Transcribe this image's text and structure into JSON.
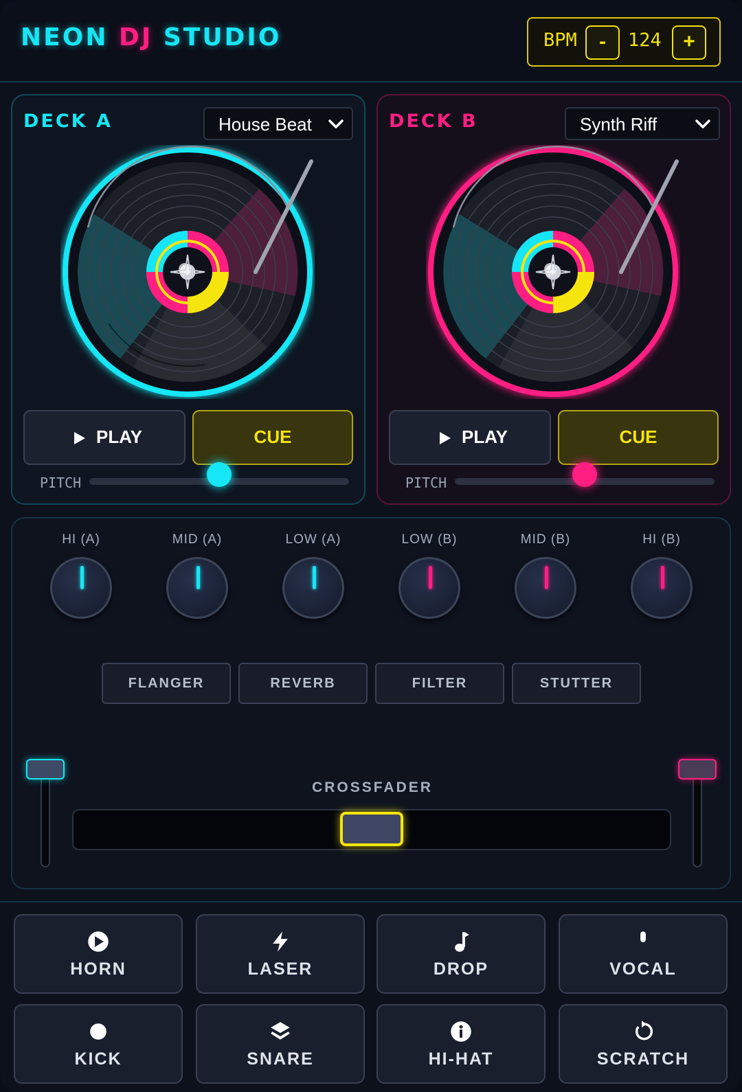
{
  "header": {
    "title_part1": "NEON",
    "title_part2": "DJ",
    "title_part3": "STUDIO",
    "bpm_label": "BPM",
    "bpm_minus": "-",
    "bpm_value": "124",
    "bpm_plus": "+"
  },
  "deck_a": {
    "label": "DECK A",
    "track": "House Beat",
    "play_label": "PLAY",
    "cue_label": "CUE",
    "pitch_label": "PITCH",
    "pitch_fraction": 0.5,
    "accent": "#16e6f5"
  },
  "deck_b": {
    "label": "DECK B",
    "track": "Synth Riff",
    "play_label": "PLAY",
    "cue_label": "CUE",
    "pitch_label": "PITCH",
    "pitch_fraction": 0.5,
    "accent": "#ff1e82"
  },
  "mixer": {
    "eq": [
      {
        "label": "HI (A)",
        "deck": "a"
      },
      {
        "label": "MID (A)",
        "deck": "a"
      },
      {
        "label": "LOW (A)",
        "deck": "a"
      },
      {
        "label": "LOW (B)",
        "deck": "b"
      },
      {
        "label": "MID (B)",
        "deck": "b"
      },
      {
        "label": "HI (B)",
        "deck": "b"
      }
    ],
    "effects": [
      "FLANGER",
      "REVERB",
      "FILTER",
      "STUTTER"
    ],
    "crossfader_label": "CROSSFADER",
    "crossfader_position": 0.5
  },
  "pads": [
    {
      "label": "HORN",
      "icon": "play-circle-icon"
    },
    {
      "label": "LASER",
      "icon": "lightning-icon"
    },
    {
      "label": "DROP",
      "icon": "music-note-icon"
    },
    {
      "label": "VOCAL",
      "icon": "microphone-icon"
    },
    {
      "label": "KICK",
      "icon": "circle-icon"
    },
    {
      "label": "SNARE",
      "icon": "layers-icon"
    },
    {
      "label": "HI-HAT",
      "icon": "info-icon"
    },
    {
      "label": "SCRATCH",
      "icon": "rotate-icon"
    }
  ],
  "colors": {
    "cyan": "#16e6f5",
    "pink": "#ff1e82",
    "yellow": "#f6e40f"
  }
}
